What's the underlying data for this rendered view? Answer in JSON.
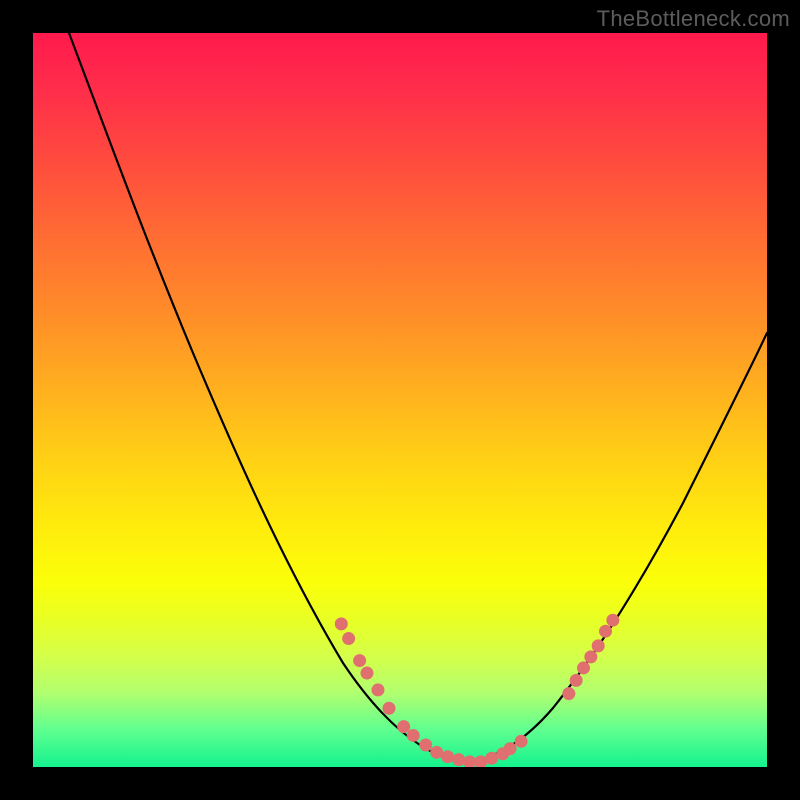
{
  "watermark": "TheBottleneck.com",
  "chart_data": {
    "type": "line",
    "title": "",
    "xlabel": "",
    "ylabel": "",
    "xlim": [
      0,
      100
    ],
    "ylim": [
      0,
      100
    ],
    "grid": false,
    "gradient_stops": [
      "#ff1a4d",
      "#ff4d3d",
      "#ff8c28",
      "#ffd015",
      "#fbff0a",
      "#d4ff4a",
      "#5eff90",
      "#14f28e"
    ],
    "series": [
      {
        "name": "bottleneck-curve-left",
        "x": [
          5,
          10,
          15,
          20,
          25,
          30,
          35,
          40,
          45,
          50,
          52,
          55,
          58,
          60
        ],
        "values": [
          100,
          90,
          79,
          68,
          57,
          46,
          35,
          24,
          14,
          6,
          4,
          2,
          1,
          0.5
        ]
      },
      {
        "name": "bottleneck-curve-right",
        "x": [
          60,
          62,
          65,
          68,
          72,
          76,
          80,
          85,
          90,
          95,
          100
        ],
        "values": [
          0.5,
          1,
          2,
          4,
          8,
          14,
          21,
          30,
          40,
          50,
          60
        ]
      }
    ],
    "markers": [
      {
        "x": 42,
        "y": 19.5
      },
      {
        "x": 43,
        "y": 17.5
      },
      {
        "x": 44.5,
        "y": 14.5
      },
      {
        "x": 45.5,
        "y": 12.8
      },
      {
        "x": 47,
        "y": 10.5
      },
      {
        "x": 48.5,
        "y": 8
      },
      {
        "x": 50.5,
        "y": 5.5
      },
      {
        "x": 51.8,
        "y": 4.3
      },
      {
        "x": 53.5,
        "y": 3.0
      },
      {
        "x": 55,
        "y": 2.0
      },
      {
        "x": 56.5,
        "y": 1.4
      },
      {
        "x": 58,
        "y": 1.0
      },
      {
        "x": 59.5,
        "y": 0.7
      },
      {
        "x": 61,
        "y": 0.7
      },
      {
        "x": 62.5,
        "y": 1.2
      },
      {
        "x": 64,
        "y": 1.8
      },
      {
        "x": 65,
        "y": 2.5
      },
      {
        "x": 66.5,
        "y": 3.5
      },
      {
        "x": 73,
        "y": 10.0
      },
      {
        "x": 74,
        "y": 11.8
      },
      {
        "x": 75,
        "y": 13.5
      },
      {
        "x": 76,
        "y": 15.0
      },
      {
        "x": 77,
        "y": 16.5
      },
      {
        "x": 78,
        "y": 18.5
      },
      {
        "x": 79,
        "y": 20.0
      }
    ]
  }
}
